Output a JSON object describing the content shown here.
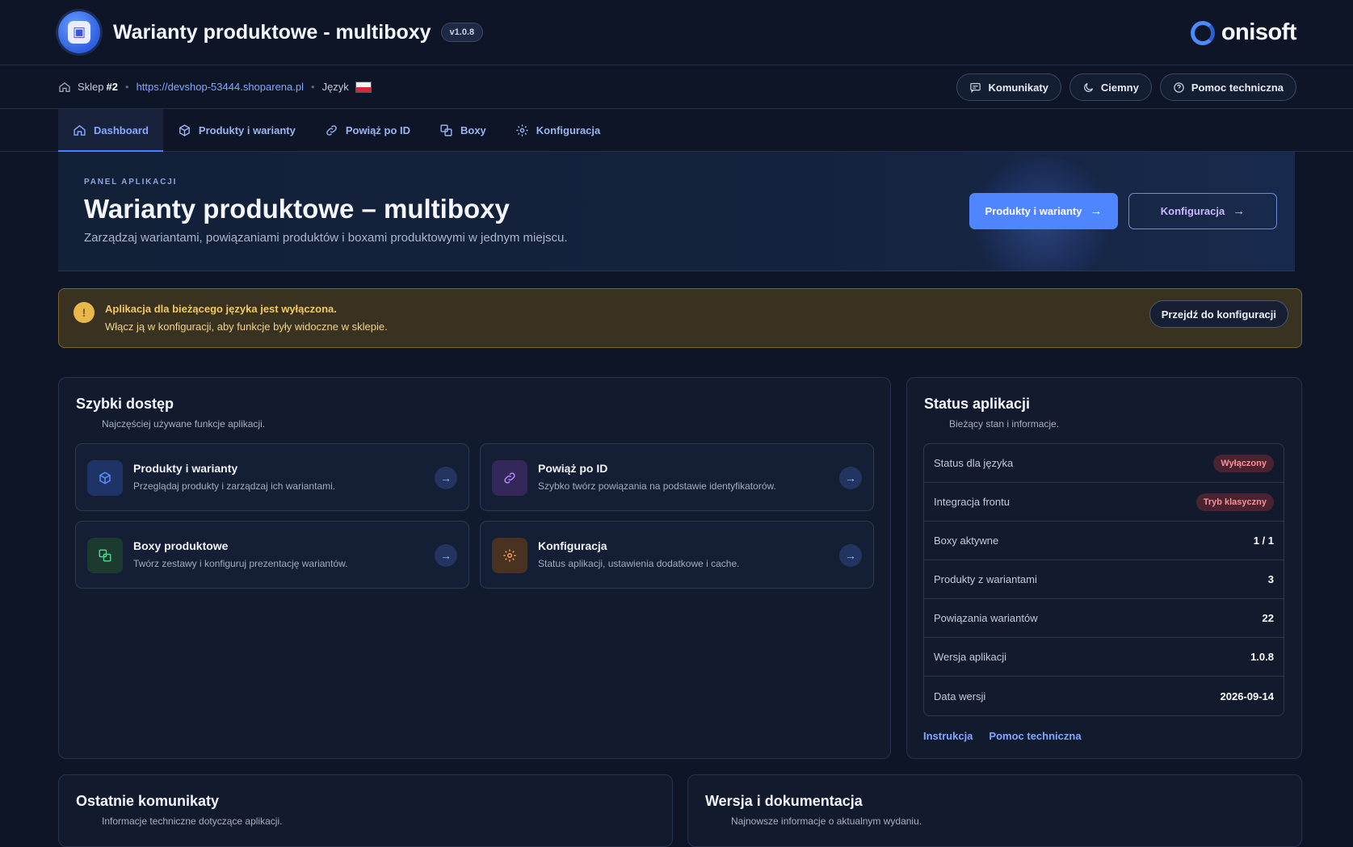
{
  "header": {
    "app_title": "Warianty produktowe - multiboxy",
    "version": "v1.0.8",
    "brand": "onisoft"
  },
  "subbar": {
    "shop_label": "Sklep",
    "shop_number": "#2",
    "shop_url": "https://devshop-53444.shoparena.pl",
    "language_label": "Język",
    "buttons": {
      "messages": "Komunikaty",
      "theme": "Ciemny",
      "support": "Pomoc techniczna"
    }
  },
  "tabs": [
    {
      "label": "Dashboard",
      "icon": "home-icon"
    },
    {
      "label": "Produkty i warianty",
      "icon": "cube-icon"
    },
    {
      "label": "Powiąż po ID",
      "icon": "link-icon"
    },
    {
      "label": "Boxy",
      "icon": "boxes-icon"
    },
    {
      "label": "Konfiguracja",
      "icon": "gear-icon"
    }
  ],
  "hero": {
    "eyebrow": "PANEL APLIKACJI",
    "title": "Warianty produktowe – multiboxy",
    "subtitle": "Zarządzaj wariantami, powiązaniami produktów i boxami produktowymi w jednym miejscu.",
    "primary_btn": "Produkty i warianty",
    "secondary_btn": "Konfiguracja",
    "arrow": "→"
  },
  "alert": {
    "title": "Aplikacja dla bieżącego języka jest wyłączona.",
    "text": "Włącz ją w konfiguracji, aby funkcje były widoczne w sklepie.",
    "button": "Przejdź do konfiguracji"
  },
  "quick_access": {
    "title": "Szybki dostęp",
    "subtitle": "Najczęściej używane funkcje aplikacji.",
    "tiles": [
      {
        "title": "Produkty i warianty",
        "desc": "Przeglądaj produkty i zarządzaj ich wariantami.",
        "icon": "cube-icon",
        "color": "#5e8cff"
      },
      {
        "title": "Powiąż po ID",
        "desc": "Szybko twórz powiązania na podstawie identyfikatorów.",
        "icon": "link-icon",
        "color": "#b48cff"
      },
      {
        "title": "Boxy produktowe",
        "desc": "Twórz zestawy i konfiguruj prezentację wariantów.",
        "icon": "boxes-icon",
        "color": "#4fd08a"
      },
      {
        "title": "Konfiguracja",
        "desc": "Status aplikacji, ustawienia dodatkowe i cache.",
        "icon": "gear-icon",
        "color": "#f0a050"
      }
    ],
    "arrow": "→"
  },
  "status": {
    "title": "Status aplikacji",
    "subtitle": "Bieżący stan i informacje.",
    "rows": [
      {
        "label": "Status dla języka",
        "value": "Wyłączony",
        "type": "badge"
      },
      {
        "label": "Integracja frontu",
        "value": "Tryb klasyczny",
        "type": "badge"
      },
      {
        "label": "Boxy aktywne",
        "value": "1 / 1",
        "type": "text"
      },
      {
        "label": "Produkty z wariantami",
        "value": "3",
        "type": "text"
      },
      {
        "label": "Powiązania wariantów",
        "value": "22",
        "type": "text"
      },
      {
        "label": "Wersja aplikacji",
        "value": "1.0.8",
        "type": "text"
      },
      {
        "label": "Data wersji",
        "value": "2026-09-14",
        "type": "text"
      }
    ],
    "links": {
      "instructions": "Instrukcja",
      "support": "Pomoc techniczna"
    }
  },
  "messages_card": {
    "title": "Ostatnie komunikaty",
    "subtitle": "Informacje techniczne dotyczące aplikacji."
  },
  "docs_card": {
    "title": "Wersja i dokumentacja",
    "subtitle": "Najnowsze informacje o aktualnym wydaniu."
  },
  "colors": {
    "accent": "#4f86ff",
    "background": "#0d1526",
    "card": "#121b2e",
    "warning": "#e9b84a",
    "danger": "#ff8d98"
  }
}
